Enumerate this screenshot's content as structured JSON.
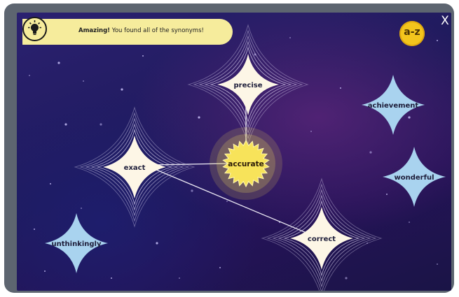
{
  "banner": {
    "strong_text": "Amazing!",
    "message": "You found all of the synonyms!"
  },
  "toolbar": {
    "az_label": "a-z",
    "close_label": "X"
  },
  "icons": [
    "lightbulb-icon",
    "az-badge-icon",
    "close-icon"
  ],
  "center_word": "accurate",
  "found_words": [
    "precise",
    "exact",
    "correct"
  ],
  "other_words": [
    "achievement",
    "wonderful",
    "unthinkingly"
  ],
  "colors": {
    "banner": "#f6ec9c",
    "found_card": "#fdf6e6",
    "other_card": "#a9d3ef",
    "sun": "#f7e35a",
    "az_badge": "#f3c51d",
    "background": "#211a5e",
    "frame": "#5d6570"
  }
}
